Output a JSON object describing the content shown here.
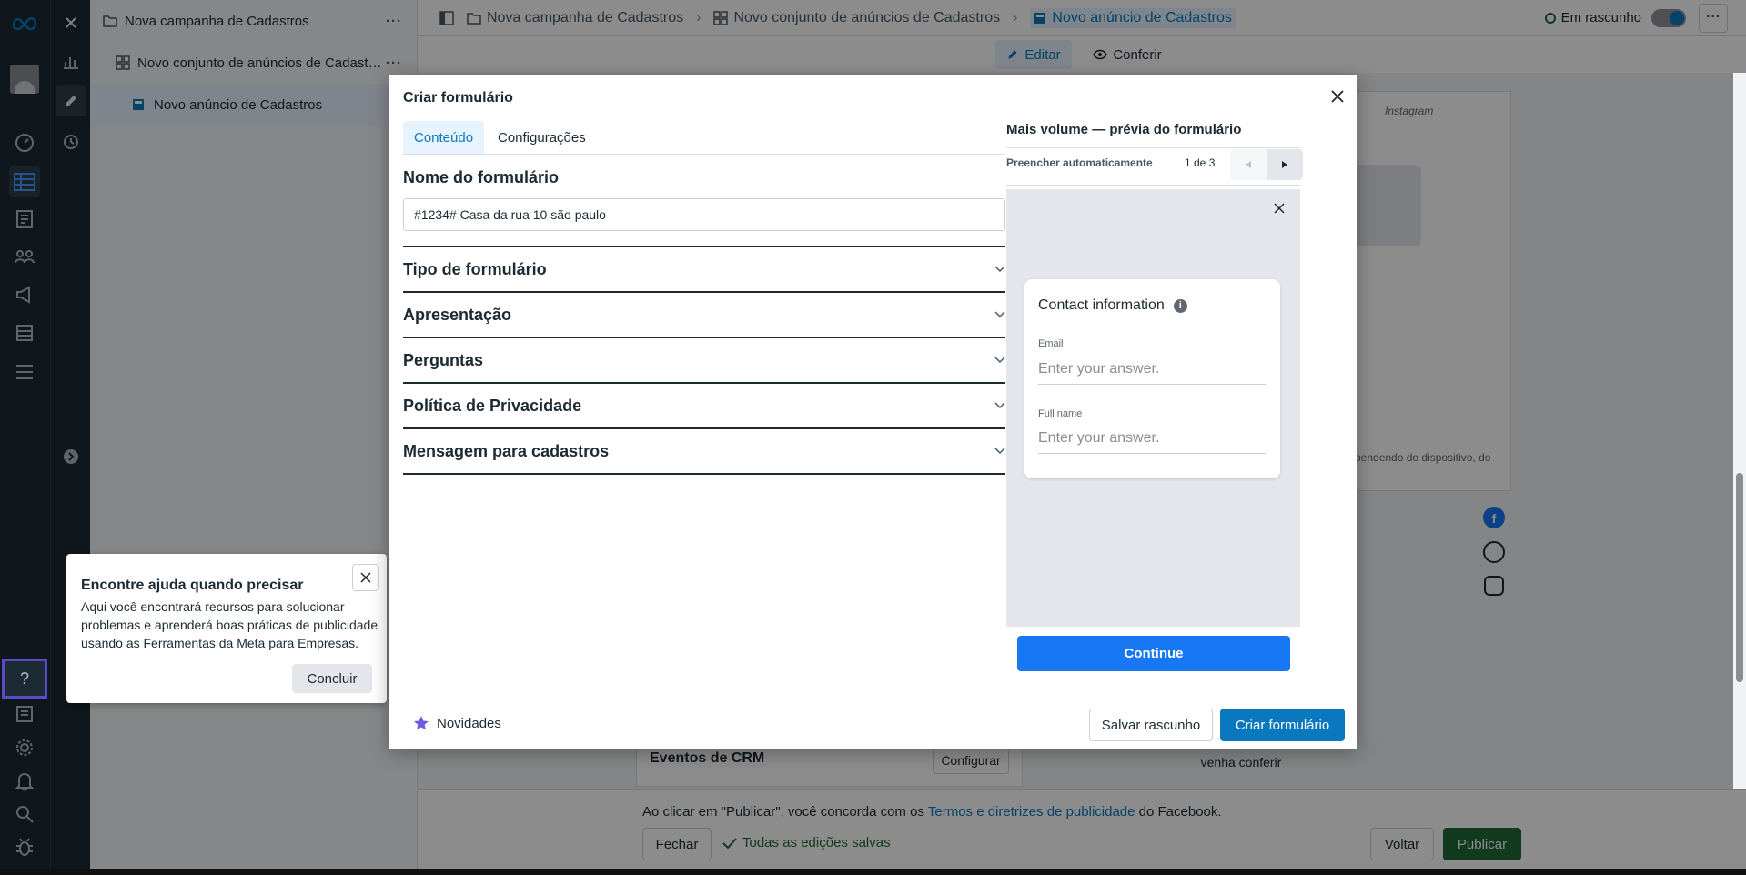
{
  "app": {
    "tree": [
      {
        "label": "Nova campanha de Cadastros",
        "icon": "folder-icon"
      },
      {
        "label": "Novo conjunto de anúncios de Cadast…",
        "icon": "grid-icon"
      },
      {
        "label": "Novo anúncio de Cadastros",
        "icon": "ad-icon"
      }
    ],
    "breadcrumb": [
      "Nova campanha de Cadastros",
      "Novo conjunto de anúncios de Cadastros",
      "Novo anúncio de Cadastros"
    ],
    "status": "Em rascunho",
    "edit_tab": "Editar",
    "review_tab": "Conferir",
    "behind_text_1": "pendendo do dispositivo, do",
    "behind_text_2": "venha conferir",
    "behind_instagram": "Instagram",
    "crm_title": "Eventos de CRM",
    "crm_button": "Configurar",
    "footer": {
      "terms_prefix": "Ao clicar em \"Publicar\", você concorda com os",
      "terms_link": "Termos e diretrizes de publicidade",
      "terms_suffix": "do Facebook.",
      "close_label": "Fechar",
      "saved_label": "Todas as edições salvas",
      "back_label": "Voltar",
      "publish_label": "Publicar"
    }
  },
  "help_popup": {
    "title": "Encontre ajuda quando precisar",
    "body": "Aqui você encontrará recursos para solucionar problemas e aprenderá boas práticas de publicidade usando as Ferramentas da Meta para Empresas.",
    "button": "Concluir"
  },
  "modal": {
    "title": "Criar formulário",
    "tabs": [
      "Conteúdo",
      "Configurações"
    ],
    "form_name_label": "Nome do formulário",
    "form_name_value": "#1234# Casa da rua 10 são paulo",
    "sections": [
      "Tipo de formulário",
      "Apresentação",
      "Perguntas",
      "Política de Privacidade",
      "Mensagem para cadastros"
    ],
    "preview": {
      "title": "Mais volume — prévia do formulário",
      "autofill": "Preencher automaticamente",
      "page": "1 de 3",
      "card_title": "Contact information",
      "fields": [
        {
          "label": "Email",
          "placeholder": "Enter your answer."
        },
        {
          "label": "Full name",
          "placeholder": "Enter your answer."
        }
      ],
      "continue": "Continue"
    },
    "footer": {
      "news": "Novidades",
      "save_draft": "Salvar rascunho",
      "create": "Criar formulário"
    }
  },
  "colors": {
    "accent": "#0a78be",
    "primary": "#1877f2",
    "publish": "#1f6b3a"
  }
}
